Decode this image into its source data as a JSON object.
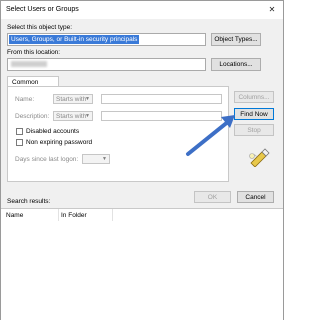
{
  "window": {
    "title": "Select Users or Groups",
    "close_glyph": "✕"
  },
  "object_type": {
    "label": "Select this object type:",
    "value": "Users, Groups, or Built-in security principals",
    "button": "Object Types..."
  },
  "location": {
    "label": "From this location:",
    "button": "Locations..."
  },
  "queries": {
    "tab_label": "Common Queries",
    "name_label": "Name:",
    "description_label": "Description:",
    "starts_with": "Starts with",
    "disabled_accounts": "Disabled accounts",
    "non_expiring_password": "Non expiring password",
    "days_since_last_logon": "Days since last logon:"
  },
  "side_buttons": {
    "columns": "Columns...",
    "find_now": "Find Now",
    "stop": "Stop"
  },
  "footer": {
    "ok": "OK",
    "cancel": "Cancel"
  },
  "results": {
    "label": "Search results:",
    "columns": [
      "Name",
      "In Folder"
    ]
  },
  "annotation": {
    "arrow_color": "#3d6fc6"
  },
  "icons": {
    "search": "search-flashlight-icon",
    "close": "close-icon"
  }
}
